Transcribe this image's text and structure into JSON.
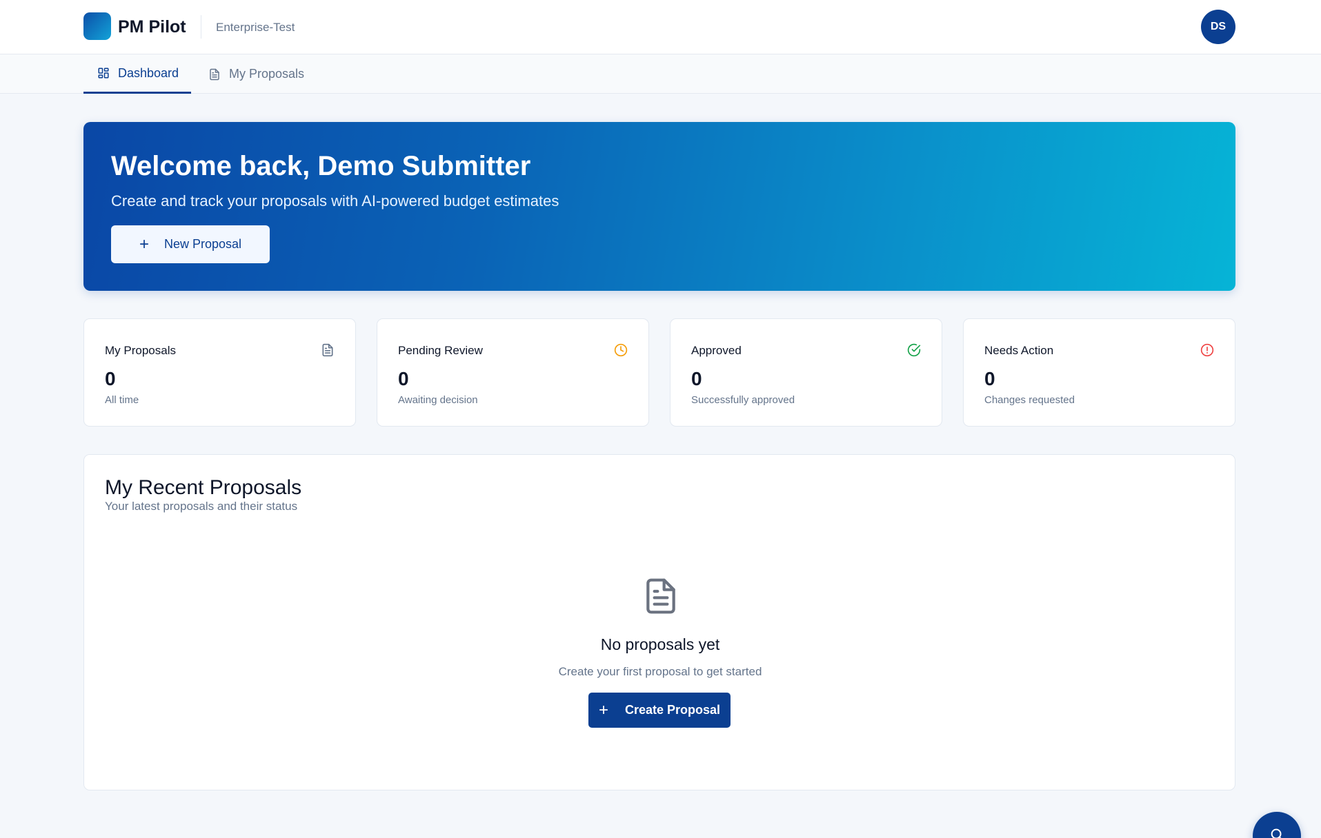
{
  "header": {
    "app_name": "PM Pilot",
    "workspace": "Enterprise-Test",
    "avatar_initials": "DS"
  },
  "tabs": [
    {
      "label": "Dashboard",
      "active": true,
      "icon": "dashboard-grid-icon"
    },
    {
      "label": "My Proposals",
      "active": false,
      "icon": "document-icon"
    }
  ],
  "hero": {
    "title": "Welcome back, Demo Submitter",
    "subtitle": "Create and track your proposals with AI-powered budget estimates",
    "button_label": "New Proposal"
  },
  "stats": [
    {
      "label": "My Proposals",
      "value": "0",
      "description": "All time",
      "icon": "document-icon",
      "color": "#64748b"
    },
    {
      "label": "Pending Review",
      "value": "0",
      "description": "Awaiting decision",
      "icon": "clock-icon",
      "color": "#f59e0b"
    },
    {
      "label": "Approved",
      "value": "0",
      "description": "Successfully approved",
      "icon": "check-circle-icon",
      "color": "#16a34a"
    },
    {
      "label": "Needs Action",
      "value": "0",
      "description": "Changes requested",
      "icon": "alert-circle-icon",
      "color": "#ef4444"
    }
  ],
  "recent": {
    "title": "My Recent Proposals",
    "subtitle": "Your latest proposals and their status",
    "empty_title": "No proposals yet",
    "empty_subtitle": "Create your first proposal to get started",
    "button_label": "Create Proposal"
  },
  "colors": {
    "primary": "#0b3f91",
    "hero_start": "#0a47a6",
    "hero_end": "#06b4d6"
  }
}
